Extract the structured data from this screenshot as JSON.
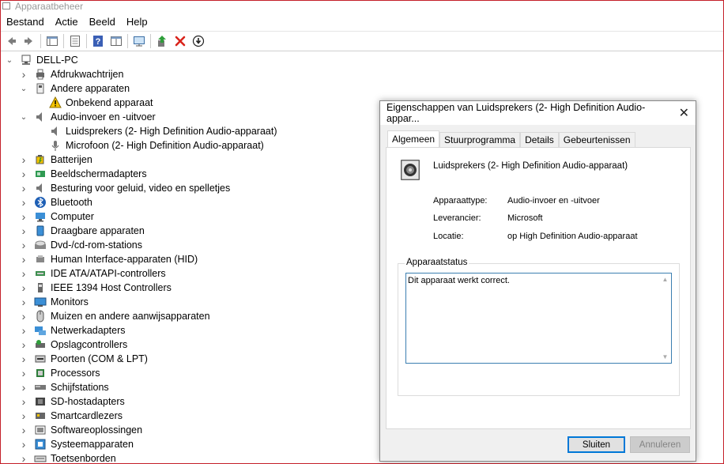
{
  "window": {
    "title": "Apparaatbeheer"
  },
  "menu": [
    "Bestand",
    "Actie",
    "Beeld",
    "Help"
  ],
  "toolbar": [
    "back-icon",
    "forward-icon",
    "properties-panel-icon",
    "list-view-icon",
    "help-icon",
    "resource-view-icon",
    "monitor-scan-icon",
    "update-driver-icon",
    "uninstall-icon",
    "download-icon"
  ],
  "tree": {
    "root": "DELL-PC",
    "items": [
      {
        "label": "Afdrukwachtrijen",
        "level": 1,
        "expanded": false,
        "icon": "printer-icon"
      },
      {
        "label": "Andere apparaten",
        "level": 1,
        "expanded": true,
        "icon": "unknown-device-icon"
      },
      {
        "label": "Onbekend apparaat",
        "level": 2,
        "expanded": null,
        "icon": "warning-icon"
      },
      {
        "label": "Audio-invoer en -uitvoer",
        "level": 1,
        "expanded": true,
        "icon": "speaker-icon"
      },
      {
        "label": "Luidsprekers (2- High Definition Audio-apparaat)",
        "level": 2,
        "expanded": null,
        "icon": "speaker-icon"
      },
      {
        "label": "Microfoon (2- High Definition Audio-apparaat)",
        "level": 2,
        "expanded": null,
        "icon": "microphone-icon"
      },
      {
        "label": "Batterijen",
        "level": 1,
        "expanded": false,
        "icon": "battery-icon"
      },
      {
        "label": "Beeldschermadapters",
        "level": 1,
        "expanded": false,
        "icon": "display-adapter-icon"
      },
      {
        "label": "Besturing voor geluid, video en spelletjes",
        "level": 1,
        "expanded": false,
        "icon": "speaker-icon"
      },
      {
        "label": "Bluetooth",
        "level": 1,
        "expanded": false,
        "icon": "bluetooth-icon"
      },
      {
        "label": "Computer",
        "level": 1,
        "expanded": false,
        "icon": "computer-icon"
      },
      {
        "label": "Draagbare apparaten",
        "level": 1,
        "expanded": false,
        "icon": "portable-device-icon"
      },
      {
        "label": "Dvd-/cd-rom-stations",
        "level": 1,
        "expanded": false,
        "icon": "disc-drive-icon"
      },
      {
        "label": "Human Interface-apparaten (HID)",
        "level": 1,
        "expanded": false,
        "icon": "hid-icon"
      },
      {
        "label": "IDE ATA/ATAPI-controllers",
        "level": 1,
        "expanded": false,
        "icon": "ide-controller-icon"
      },
      {
        "label": "IEEE 1394 Host Controllers",
        "level": 1,
        "expanded": false,
        "icon": "ieee1394-icon"
      },
      {
        "label": "Monitors",
        "level": 1,
        "expanded": false,
        "icon": "monitor-icon"
      },
      {
        "label": "Muizen en andere aanwijsapparaten",
        "level": 1,
        "expanded": false,
        "icon": "mouse-icon"
      },
      {
        "label": "Netwerkadapters",
        "level": 1,
        "expanded": false,
        "icon": "network-adapter-icon"
      },
      {
        "label": "Opslagcontrollers",
        "level": 1,
        "expanded": false,
        "icon": "storage-controller-icon"
      },
      {
        "label": "Poorten (COM & LPT)",
        "level": 1,
        "expanded": false,
        "icon": "port-icon"
      },
      {
        "label": "Processors",
        "level": 1,
        "expanded": false,
        "icon": "processor-icon"
      },
      {
        "label": "Schijfstations",
        "level": 1,
        "expanded": false,
        "icon": "disk-drive-icon"
      },
      {
        "label": "SD-hostadapters",
        "level": 1,
        "expanded": false,
        "icon": "sd-adapter-icon"
      },
      {
        "label": "Smartcardlezers",
        "level": 1,
        "expanded": false,
        "icon": "smartcard-icon"
      },
      {
        "label": "Softwareoplossingen",
        "level": 1,
        "expanded": false,
        "icon": "software-icon"
      },
      {
        "label": "Systeemapparaten",
        "level": 1,
        "expanded": false,
        "icon": "system-device-icon"
      },
      {
        "label": "Toetsenborden",
        "level": 1,
        "expanded": false,
        "icon": "keyboard-icon"
      }
    ]
  },
  "dialog": {
    "title": "Eigenschappen van Luidsprekers (2- High Definition Audio-appar...",
    "tabs": [
      "Algemeen",
      "Stuurprogramma",
      "Details",
      "Gebeurtenissen"
    ],
    "active_tab": "Algemeen",
    "device_name": "Luidsprekers (2- High Definition Audio-apparaat)",
    "props": [
      {
        "label": "Apparaattype:",
        "value": "Audio-invoer en -uitvoer"
      },
      {
        "label": "Leverancier:",
        "value": "Microsoft"
      },
      {
        "label": "Locatie:",
        "value": "op High Definition Audio-apparaat"
      }
    ],
    "status_legend": "Apparaatstatus",
    "status_text": "Dit apparaat werkt correct.",
    "buttons": {
      "ok": "Sluiten",
      "cancel": "Annuleren"
    }
  },
  "colors": {
    "window_border": "#c4202a",
    "focus_blue": "#3c7fb1",
    "uninstall_red": "#d9241c"
  }
}
